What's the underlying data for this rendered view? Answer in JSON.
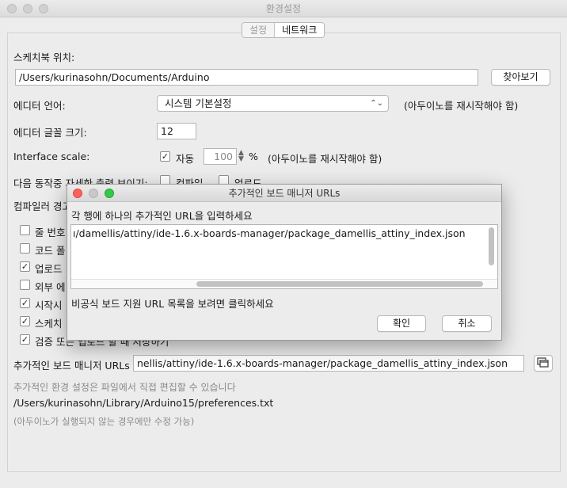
{
  "window": {
    "title": "환경설정"
  },
  "tabs": [
    {
      "label": "설정"
    },
    {
      "label": "네트워크"
    }
  ],
  "sketchbook": {
    "label": "스케치북 위치:",
    "path": "/Users/kurinasohn/Documents/Arduino",
    "browse_label": "찾아보기"
  },
  "editor_language": {
    "label": "에디터 언어:",
    "value": "시스템 기본설정",
    "note": "(아두이노를 재시작해야 함)"
  },
  "font_size": {
    "label": "에디터 글꼴 크기:",
    "value": "12"
  },
  "interface_scale": {
    "label": "Interface scale:",
    "auto_label": "자동",
    "auto_checked": true,
    "value": "100",
    "unit": "%",
    "note": "(아두이노를 재시작해야 함)"
  },
  "verbose": {
    "label": "다음 동작중 자세한  출력 보이기:",
    "compile_label": "컴파일",
    "upload_label": "업로드"
  },
  "compiler_warnings": {
    "label": "컴파일러 경고"
  },
  "options": [
    {
      "label": "줄 번호",
      "checked": false
    },
    {
      "label": "코드 폴",
      "checked": false
    },
    {
      "label": "업로드",
      "checked": true
    },
    {
      "label": "외부 에",
      "checked": false
    },
    {
      "label": "시작시",
      "checked": true
    },
    {
      "label": "스케치",
      "checked": true
    },
    {
      "label": "검증 또는 업로드 할 때 저장하기",
      "checked": true
    }
  ],
  "boards_manager": {
    "label": "추가적인 보드 매니저 URLs",
    "value": "nellis/attiny/ide-1.6.x-boards-manager/package_damellis_attiny_index.json"
  },
  "footer": {
    "more_prefs": "추가적인 환경 설정은 파일에서 직접 편집할 수 있습니다",
    "prefs_path": "/Users/kurinasohn/Library/Arduino15/preferences.txt",
    "note": "(아두이노가 실행되지 않는 경우에만 수정 가능)"
  },
  "dialog": {
    "title": "추가적인 보드 매니저 URLs",
    "instruction": "각 행에 하나의 추가적인 URL을 입력하세요",
    "url_text": "ı/damellis/attiny/ide-1.6.x-boards-manager/package_damellis_attiny_index.json",
    "unofficial_link": "비공식 보드 지원 URL 목록을 보려면 클릭하세요",
    "ok_label": "확인",
    "cancel_label": "취소",
    "close_color": "#fc605b",
    "minimize_color": "#c8c8c8",
    "zoom_color": "#34c84a"
  }
}
